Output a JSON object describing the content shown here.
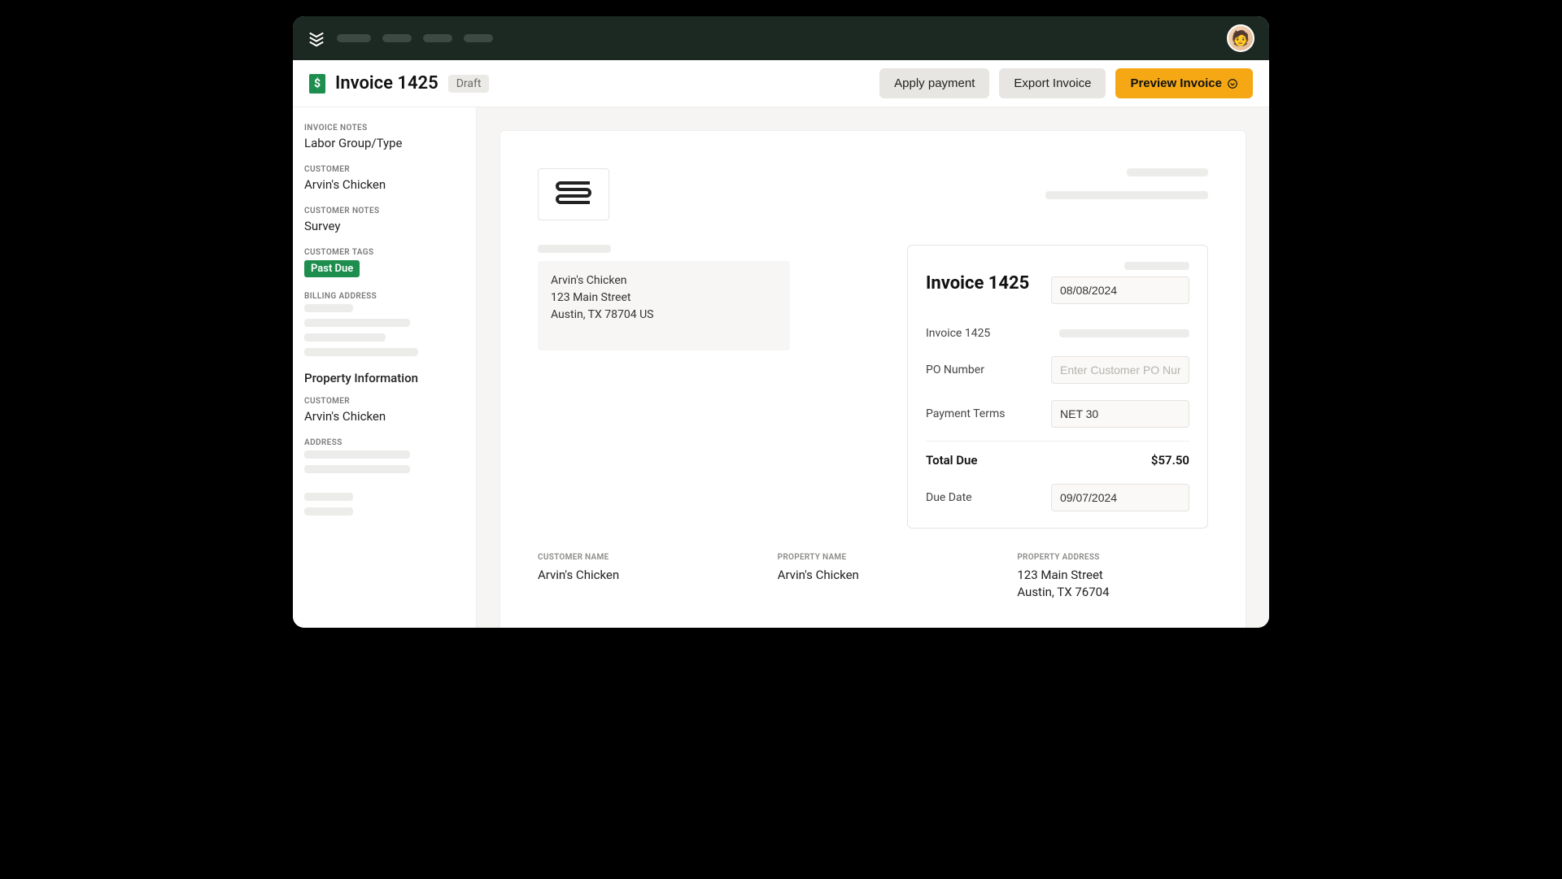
{
  "header": {
    "icon": "dollar-doc-icon",
    "title": "Invoice 1425",
    "status": "Draft",
    "buttons": {
      "apply_payment": "Apply payment",
      "export_invoice": "Export Invoice",
      "preview_invoice": "Preview Invoice"
    }
  },
  "sidebar": {
    "invoice_notes_label": "INVOICE NOTES",
    "invoice_notes": "Labor Group/Type",
    "customer_label": "CUSTOMER",
    "customer": "Arvin's Chicken",
    "customer_notes_label": "CUSTOMER NOTES",
    "customer_notes": "Survey",
    "customer_tags_label": "CUSTOMER TAGS",
    "customer_tag": "Past Due",
    "billing_address_label": "BILLING ADDRESS",
    "property_info_heading": "Property Information",
    "prop_customer_label": "CUSTOMER",
    "prop_customer": "Arvin's Chicken",
    "address_label": "ADDRESS"
  },
  "sheet": {
    "bill_to": {
      "name": "Arvin's Chicken",
      "street": "123 Main Street",
      "city_state": "Austin, TX 78704 US"
    },
    "invoice": {
      "title": "Invoice 1425",
      "date": "08/08/2024",
      "number_label": "Invoice 1425",
      "po_label": "PO Number",
      "po_placeholder": "Enter Customer PO Num...",
      "terms_label": "Payment Terms",
      "terms_value": "NET 30",
      "total_due_label": "Total Due",
      "total_due": "$57.50",
      "due_date_label": "Due Date",
      "due_date": "09/07/2024"
    },
    "details": {
      "customer_name_label": "CUSTOMER NAME",
      "customer_name": "Arvin's Chicken",
      "property_name_label": "PROPERTY NAME",
      "property_name": "Arvin's Chicken",
      "property_address_label": "PROPERTY ADDRESS",
      "property_address_line1": "123 Main Street",
      "property_address_line2": "Austin, TX 76704"
    }
  }
}
